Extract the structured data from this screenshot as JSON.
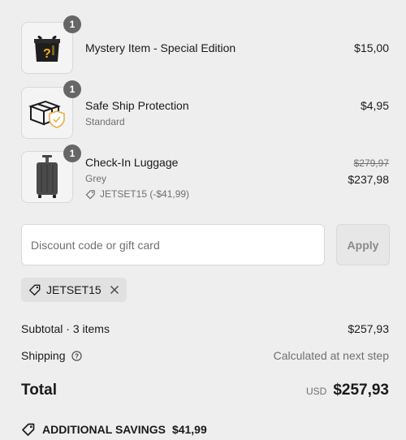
{
  "items": [
    {
      "name": "Mystery Item - Special Edition",
      "quantity": "1",
      "price": "$15,00",
      "thumb_icon": "mystery-box-icon"
    },
    {
      "name": "Safe Ship Protection",
      "variant": "Standard",
      "quantity": "1",
      "price": "$4,95",
      "thumb_icon": "shield-package-icon"
    },
    {
      "name": "Check-In Luggage",
      "variant": "Grey",
      "quantity": "1",
      "compare_price": "$279,97",
      "price": "$237,98",
      "discount_line": "JETSET15 (-$41,99)",
      "thumb_icon": "suitcase-icon"
    }
  ],
  "discount": {
    "placeholder": "Discount code or gift card",
    "apply_label": "Apply",
    "applied_code": "JETSET15"
  },
  "summary": {
    "subtotal_label": "Subtotal · 3 items",
    "subtotal_value": "$257,93",
    "shipping_label": "Shipping",
    "shipping_value": "Calculated at next step",
    "total_label": "Total",
    "currency": "USD",
    "total_value": "$257,93",
    "savings_label": "ADDITIONAL SAVINGS",
    "savings_value": "$41,99"
  },
  "colors": {
    "background": "#eeeeee",
    "badge": "#666666",
    "muted_text": "#707070"
  }
}
